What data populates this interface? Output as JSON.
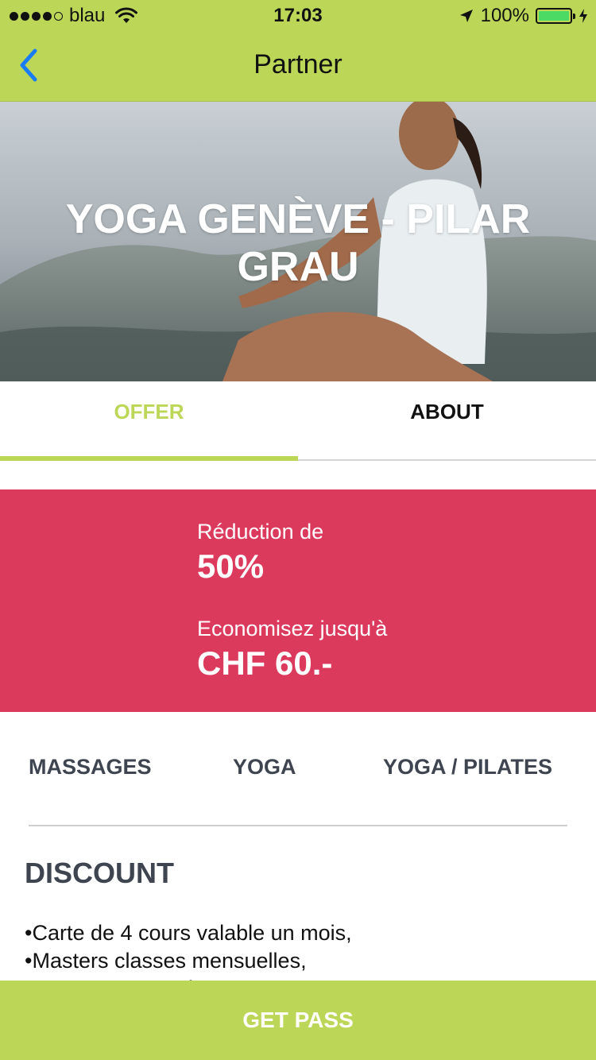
{
  "status_bar": {
    "carrier": "blau",
    "time": "17:03",
    "battery": "100%",
    "icons": [
      "signal-dots-icon",
      "wifi-icon",
      "location-arrow-icon",
      "battery-icon",
      "charging-bolt-icon"
    ]
  },
  "nav": {
    "title": "Partner",
    "back_icon": "chevron-left-icon"
  },
  "hero": {
    "title": "YOGA GENÈVE - PILAR GRAU"
  },
  "tabs": [
    {
      "label": "OFFER",
      "active": true
    },
    {
      "label": "ABOUT",
      "active": false
    }
  ],
  "offer": {
    "reduction_label": "Réduction de",
    "reduction_value": "50%",
    "savings_label": "Economisez jusqu'à",
    "savings_value": "CHF 60.-"
  },
  "categories": [
    "MASSAGES",
    "YOGA",
    "YOGA / PILATES"
  ],
  "discount": {
    "title": "DISCOUNT",
    "items": [
      "Carte de 4 cours valable un mois,",
      "Masters classes mensuelles,",
      "Massages au sein"
    ]
  },
  "cta": {
    "label": "GET PASS"
  },
  "colors": {
    "accent": "#bcd757",
    "offer_background": "#dc3a5c",
    "ios_blue": "#1a7cf5",
    "text_dark": "#3e4450"
  }
}
